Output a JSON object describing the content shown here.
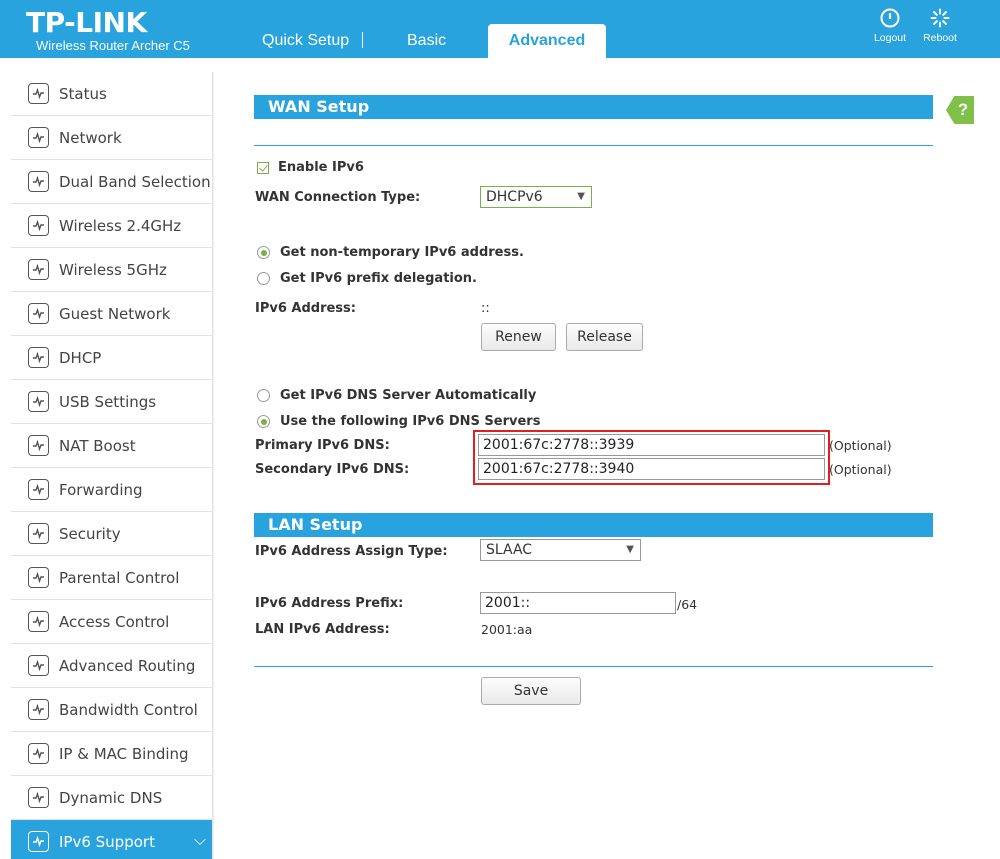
{
  "header": {
    "brand": "TP-LINK",
    "model": "Wireless Router Archer C5",
    "tabs": [
      {
        "label": "Quick Setup"
      },
      {
        "label": "Basic"
      },
      {
        "label": "Advanced"
      }
    ],
    "logout_label": "Logout",
    "reboot_label": "Reboot",
    "accent_color": "#29a3dd"
  },
  "sidebar": {
    "items": [
      {
        "label": "Status",
        "icon": "status-icon"
      },
      {
        "label": "Network",
        "icon": "globe-icon"
      },
      {
        "label": "Dual Band Selection",
        "icon": "dual-band-icon"
      },
      {
        "label": "Wireless 2.4GHz",
        "icon": "wireless-icon"
      },
      {
        "label": "Wireless 5GHz",
        "icon": "wireless-icon"
      },
      {
        "label": "Guest Network",
        "icon": "guest-icon"
      },
      {
        "label": "DHCP",
        "icon": "dhcp-icon"
      },
      {
        "label": "USB Settings",
        "icon": "usb-icon"
      },
      {
        "label": "NAT Boost",
        "icon": "nat-icon"
      },
      {
        "label": "Forwarding",
        "icon": "forwarding-icon"
      },
      {
        "label": "Security",
        "icon": "lock-icon"
      },
      {
        "label": "Parental Control",
        "icon": "parental-icon"
      },
      {
        "label": "Access Control",
        "icon": "access-icon"
      },
      {
        "label": "Advanced Routing",
        "icon": "routing-icon"
      },
      {
        "label": "Bandwidth Control",
        "icon": "bandwidth-icon"
      },
      {
        "label": "IP & MAC Binding",
        "icon": "binding-icon"
      },
      {
        "label": "Dynamic DNS",
        "icon": "ddns-icon"
      },
      {
        "label": "IPv6 Support",
        "icon": "ipv6-icon",
        "active": true
      }
    ]
  },
  "wan": {
    "title": "WAN Setup",
    "enable_ipv6_label": "Enable IPv6",
    "enable_ipv6_checked": true,
    "conn_type_label": "WAN Connection Type:",
    "conn_type_value": "DHCPv6",
    "radio_nontemp_label": "Get non-temporary IPv6 address.",
    "radio_prefix_label": "Get IPv6 prefix delegation.",
    "ipv6_address_label": "IPv6 Address:",
    "ipv6_address_value": "::",
    "renew_label": "Renew",
    "release_label": "Release",
    "dns_auto_label": "Get IPv6 DNS Server Automatically",
    "dns_manual_label": "Use the following IPv6 DNS Servers",
    "primary_dns_label": "Primary IPv6 DNS:",
    "primary_dns_value": "2001:67c:2778::3939",
    "secondary_dns_label": "Secondary IPv6 DNS:",
    "secondary_dns_value": "2001:67c:2778::3940",
    "optional_label": "(Optional)"
  },
  "lan": {
    "title": "LAN Setup",
    "assign_type_label": "IPv6 Address Assign Type:",
    "assign_type_value": "SLAAC",
    "prefix_label": "IPv6 Address Prefix:",
    "prefix_value": "2001::",
    "prefix_suffix": "/64",
    "lan_address_label": "LAN IPv6 Address:",
    "lan_address_value": "2001:aa"
  },
  "save_label": "Save",
  "help_label": "?"
}
